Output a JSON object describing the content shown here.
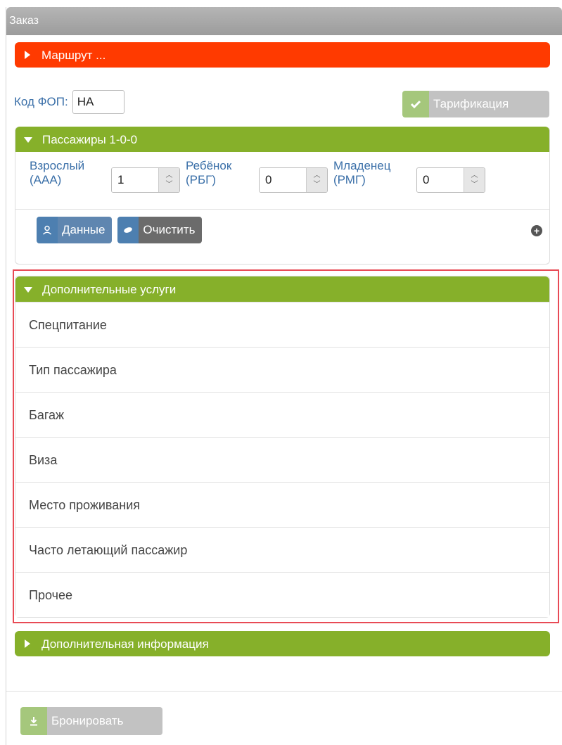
{
  "window": {
    "title": "Заказ"
  },
  "route": {
    "label": "Маршрут ..."
  },
  "fop": {
    "label": "Код ФОП:",
    "value": "НА"
  },
  "tarif_button": {
    "label": "Тарификация",
    "icon": "check-icon"
  },
  "passengers": {
    "title": "Пассажиры 1-0-0",
    "fields": [
      {
        "label_line1": "Взрослый",
        "label_line2": "(ААА)",
        "value": "1"
      },
      {
        "label_line1": "Ребёнок",
        "label_line2": "(РБГ)",
        "value": "0"
      },
      {
        "label_line1": "Младенец",
        "label_line2": "(РМГ)",
        "value": "0"
      }
    ],
    "data_button": "Данные",
    "clear_button": "Очистить"
  },
  "extra_services": {
    "title": "Дополнительные услуги",
    "items": [
      "Спецпитание",
      "Тип пассажира",
      "Багаж",
      "Виза",
      "Место проживания",
      "Часто летающий пассажир",
      "Прочее"
    ]
  },
  "extra_info": {
    "title": "Дополнительная информация"
  },
  "book_button": {
    "label": "Бронировать",
    "icon": "download-icon"
  },
  "colors": {
    "route": "#ff3a00",
    "section": "#86b02a",
    "highlight": "#e84a55"
  }
}
